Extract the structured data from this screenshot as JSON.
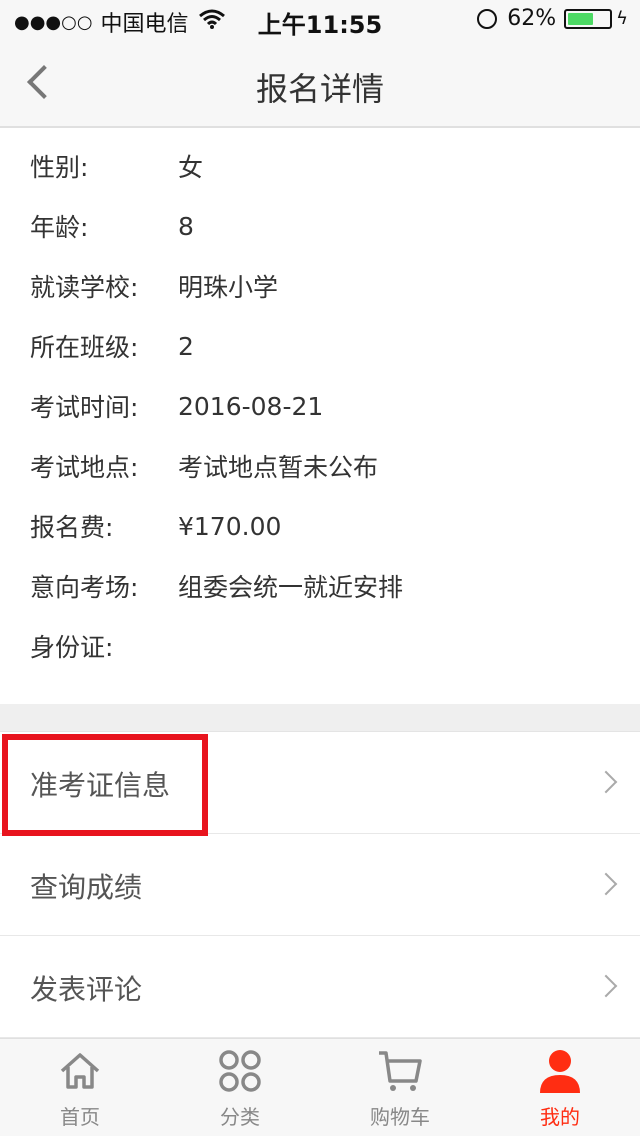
{
  "status_bar": {
    "signal": "●●●○○",
    "carrier": "中国电信",
    "time": "上午11:55",
    "battery_text": "62%",
    "battery_level": 0.62
  },
  "nav": {
    "title": "报名详情"
  },
  "details": [
    {
      "label": "性别:",
      "value": "女"
    },
    {
      "label": "年龄:",
      "value": "8"
    },
    {
      "label": "就读学校:",
      "value": "明珠小学"
    },
    {
      "label": "所在班级:",
      "value": "2"
    },
    {
      "label": "考试时间:",
      "value": "2016-08-21"
    },
    {
      "label": "考试地点:",
      "value": "考试地点暂未公布"
    },
    {
      "label": "报名费:",
      "value": "¥170.00"
    },
    {
      "label": "意向考场:",
      "value": "组委会统一就近安排"
    },
    {
      "label": "身份证:",
      "value": ""
    }
  ],
  "menu": [
    {
      "label": "准考证信息"
    },
    {
      "label": "查询成绩"
    },
    {
      "label": "发表评论"
    }
  ],
  "tabs": [
    {
      "label": "首页",
      "icon": "home-icon"
    },
    {
      "label": "分类",
      "icon": "category-icon"
    },
    {
      "label": "购物车",
      "icon": "cart-icon"
    },
    {
      "label": "我的",
      "icon": "user-icon"
    }
  ],
  "colors": {
    "accent": "#ff2d12",
    "highlight": "#e8141e",
    "battery": "#4cd964"
  }
}
